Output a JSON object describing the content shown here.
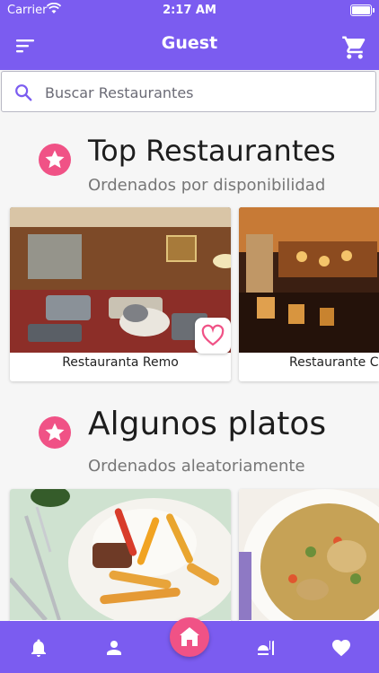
{
  "status_bar": {
    "carrier": "Carrier",
    "time": "2:17 AM"
  },
  "app_bar": {
    "title": "Guest",
    "cart_count": "0"
  },
  "search": {
    "placeholder": "Buscar Restaurantes"
  },
  "sections": [
    {
      "title": "Top Restaurantes",
      "subtitle": "Ordenados por disponibilidad",
      "cards": [
        {
          "label": "Restauranta Remo"
        },
        {
          "label": "Restaurante C"
        }
      ]
    },
    {
      "title": "Algunos platos",
      "subtitle": "Ordenados aleatoriamente",
      "cards": [
        {
          "label": ""
        },
        {
          "label": ""
        }
      ]
    }
  ],
  "colors": {
    "primary": "#7b5cf0",
    "accent": "#f05286"
  },
  "nav": [
    "bell-icon",
    "person-icon",
    "home-icon",
    "restaurant-icon",
    "heart-icon"
  ]
}
